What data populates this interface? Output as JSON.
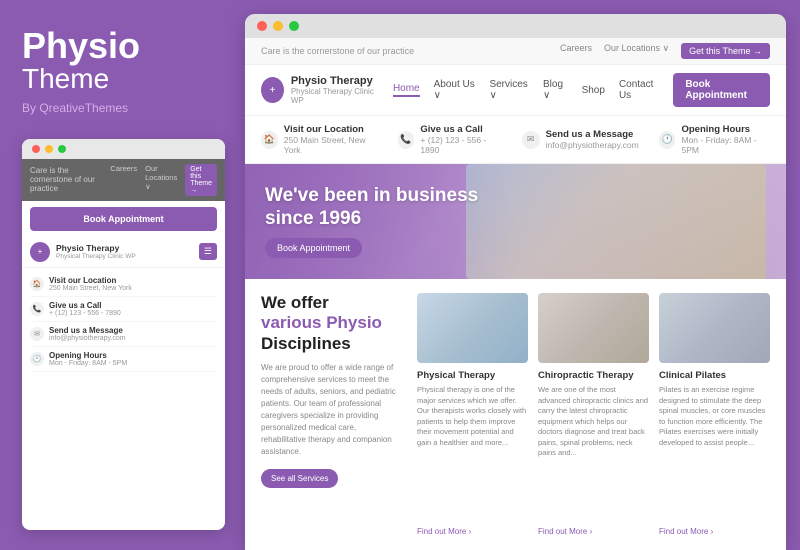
{
  "brand": {
    "title": "Physio",
    "subtitle": "Theme",
    "by": "By QreativeThemes"
  },
  "browser_dots": [
    "red",
    "yellow",
    "green"
  ],
  "mini": {
    "topbar_text": "Care is the cornerstone of our practice",
    "nav_careers": "Careers",
    "nav_locations": "Our Locations ∨",
    "nav_get_theme": "Get this Theme →",
    "book_btn": "Book Appointment",
    "site_name": "Physio Therapy",
    "site_sub": "Physical Therapy Clinic WP",
    "info_rows": [
      {
        "icon": "🏠",
        "label": "Visit our Location",
        "value": "250 Main Street, New York"
      },
      {
        "icon": "📞",
        "label": "Give us a Call",
        "value": "+ (12) 123 - 556 - 7890"
      },
      {
        "icon": "✉",
        "label": "Send us a Message",
        "value": "info@physiotherapy.com"
      },
      {
        "icon": "🕐",
        "label": "Opening Hours",
        "value": "Mon - Friday: 8AM - 5PM"
      }
    ]
  },
  "desktop": {
    "topbar_text": "Care is the cornerstone of our practice",
    "top_links": [
      "Careers",
      "Our Locations ∨",
      "Get this Theme →"
    ],
    "nav": {
      "site_name": "Physio Therapy",
      "site_sub": "Physical Therapy Clinic WP",
      "links": [
        "Home",
        "About Us ∨",
        "Services ∨",
        "Blog ∨",
        "Shop",
        "Contact Us"
      ],
      "book_btn": "Book Appointment"
    },
    "info_bar": [
      {
        "icon": "🏠",
        "label": "Visit our Location",
        "value": "250 Main Street, New York"
      },
      {
        "icon": "📞",
        "label": "Give us a Call",
        "value": "+ (12) 123 - 556 - 1890"
      },
      {
        "icon": "✉",
        "label": "Send us a Message",
        "value": "info@physiotherapy.com"
      },
      {
        "icon": "🕐",
        "label": "Opening Hours",
        "value": "Mon - Friday: 8AM - 5PM"
      }
    ],
    "hero": {
      "title_line1": "We've been in business",
      "title_line2": "since 1996",
      "book_btn": "Book Appointment"
    },
    "offer": {
      "title_line1": "We offer",
      "title_line2": "various Physio",
      "title_line3": "Disciplines",
      "description": "We are proud to offer a wide range of comprehensive services to meet the needs of adults, seniors, and pediatric patients. Our team of professional caregivers specialize in providing personalized medical care, rehabilitative therapy and companion assistance.",
      "btn_label": "See all Services"
    },
    "cards": [
      {
        "title": "Physical Therapy",
        "description": "Physical therapy is one of the major services which we offer. Our therapists works closely with patients to help them improve their movement potential and gain a healthier and more...",
        "link": "Find out More ›",
        "img_type": "pt"
      },
      {
        "title": "Chiropractic Therapy",
        "description": "We are one of the most advanced chiropractic clinics and carry the latest chiropractic equipment which helps our doctors diagnose and treat back pains, spinal problems, neck pains and...",
        "link": "Find out More ›",
        "img_type": "ct"
      },
      {
        "title": "Clinical Pilates",
        "description": "Pilates is an exercise regime designed to stimulate the deep spinal muscles, or core muscles to function more efficiently. The Pilates exercises were initially developed to assist people...",
        "link": "Find out More ›",
        "img_type": "cp"
      }
    ]
  }
}
